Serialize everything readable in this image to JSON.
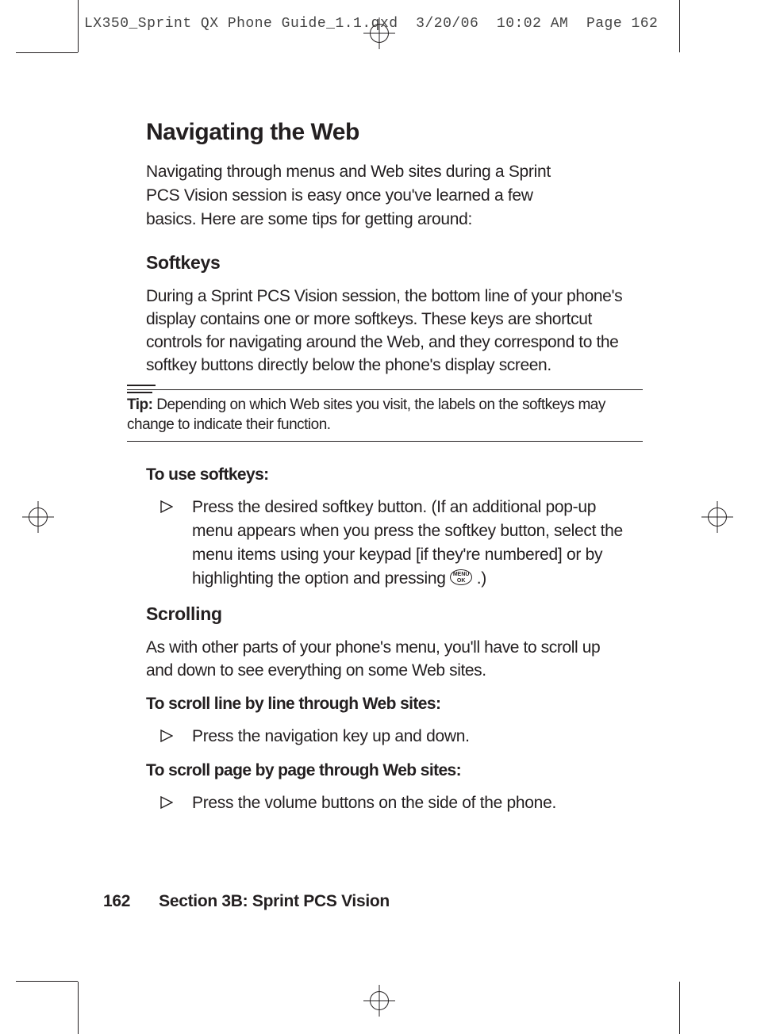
{
  "header": {
    "filename": "LX350_Sprint QX Phone Guide_1.1.qxd",
    "date": "3/20/06",
    "time": "10:02 AM",
    "page_label": "Page 162"
  },
  "title": "Navigating the Web",
  "intro": "Navigating through menus and Web sites during a Sprint PCS Vision session is easy once you've learned a few basics. Here are some tips for getting around:",
  "softkeys": {
    "heading": "Softkeys",
    "body": "During a Sprint PCS Vision session, the bottom line of your phone's display contains one or more softkeys. These keys are shortcut controls for navigating around the Web, and they correspond to the softkey buttons directly below the phone's display screen.",
    "tip_label": "Tip:",
    "tip_text": " Depending on which Web sites you visit, the labels on the softkeys may change to indicate their function.",
    "use_heading": "To use softkeys:",
    "use_bullet_a": "Press the desired softkey button. (If an additional pop-up menu appears when you press the softkey button, select the menu items using your keypad [if they're numbered] or by highlighting the option and pressing ",
    "use_bullet_b": " .)"
  },
  "scrolling": {
    "heading": "Scrolling",
    "body": "As with other parts of your phone's menu, you'll have to scroll up and down to see everything on some Web sites.",
    "line_heading": "To scroll line by line through Web sites:",
    "line_bullet": "Press the navigation key up and down.",
    "page_heading": "To scroll page by page through Web sites:",
    "page_bullet": "Press the volume buttons on the side of the phone."
  },
  "footer": {
    "page_number": "162",
    "section": "Section 3B: Sprint PCS Vision"
  },
  "icons": {
    "menu_ok_top": "MENU",
    "menu_ok_bottom": "OK"
  }
}
